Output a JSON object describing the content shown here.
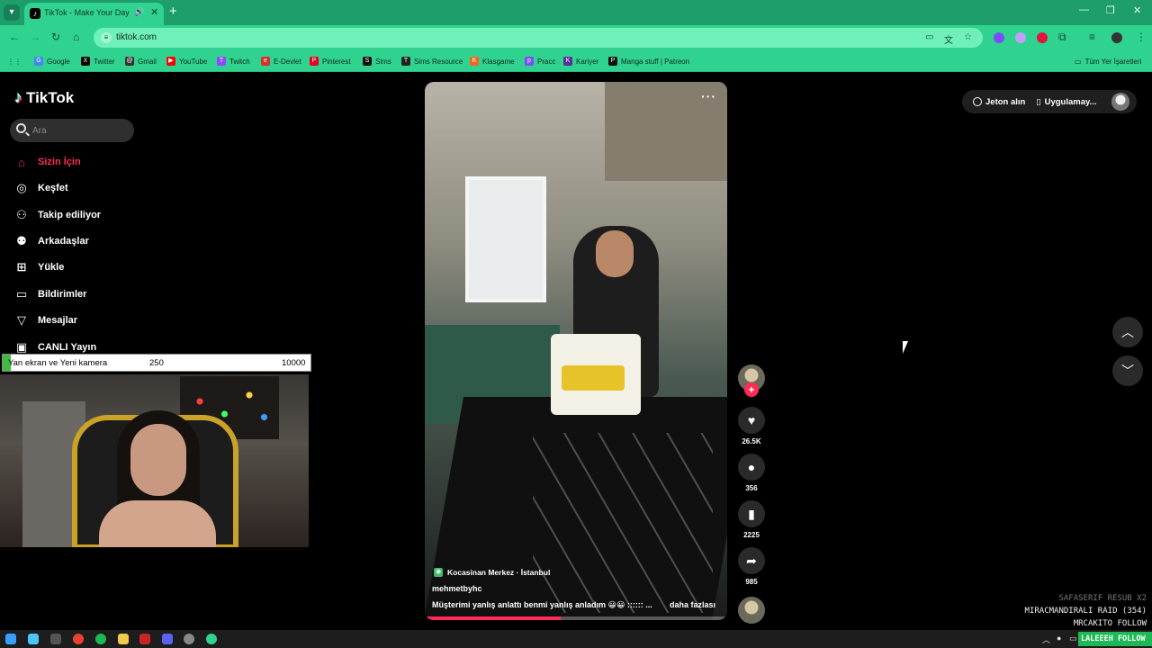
{
  "browser": {
    "tab": {
      "title": "TikTok - Make Your Day",
      "favicon": "tiktok-icon"
    },
    "url": "tiktok.com",
    "bookmarks": [
      {
        "label": "Google",
        "color": "#4285f4",
        "glyph": "G"
      },
      {
        "label": "Twitter",
        "color": "#000000",
        "glyph": "X"
      },
      {
        "label": "Gmail",
        "color": "#333333",
        "glyph": "@"
      },
      {
        "label": "YouTube",
        "color": "#ff0000",
        "glyph": "▶"
      },
      {
        "label": "Twitch",
        "color": "#9146ff",
        "glyph": "T"
      },
      {
        "label": "E-Devlet",
        "color": "#d9302b",
        "glyph": "e"
      },
      {
        "label": "Pinterest",
        "color": "#e60023",
        "glyph": "P"
      },
      {
        "label": "Sims",
        "color": "#111111",
        "glyph": "S"
      },
      {
        "label": "Sims Resource",
        "color": "#222222",
        "glyph": "T"
      },
      {
        "label": "Klasgame",
        "color": "#f26522",
        "glyph": "K"
      },
      {
        "label": "Pracc",
        "color": "#7c4dff",
        "glyph": "p"
      },
      {
        "label": "Kariyer",
        "color": "#5a2ca0",
        "glyph": "K"
      },
      {
        "label": "Manga stuff | Patreon",
        "color": "#111111",
        "glyph": "P"
      }
    ],
    "all_bookmarks": "Tüm Yer İşaretleri"
  },
  "sidebar": {
    "logo": "TikTok",
    "search_placeholder": "Ara",
    "items": [
      {
        "label": "Sizin İçin",
        "icon": "home-icon",
        "glyph": "⌂",
        "active": true
      },
      {
        "label": "Keşfet",
        "icon": "compass-icon",
        "glyph": "◎"
      },
      {
        "label": "Takip ediliyor",
        "icon": "following-icon",
        "glyph": "⚇"
      },
      {
        "label": "Arkadaşlar",
        "icon": "friends-icon",
        "glyph": "⚉"
      },
      {
        "label": "Yükle",
        "icon": "upload-icon",
        "glyph": "⊞"
      },
      {
        "label": "Bildirimler",
        "icon": "notifications-icon",
        "glyph": "▭"
      },
      {
        "label": "Mesajlar",
        "icon": "messages-icon",
        "glyph": "▽"
      },
      {
        "label": "CANLI Yayın",
        "icon": "live-icon",
        "glyph": "▣"
      }
    ]
  },
  "overlay": {
    "label": "Yan ekran ve Yeni kamera",
    "current": "250",
    "goal": "10000",
    "progress": 0.025
  },
  "video": {
    "location": "Kocasinan Merkez · İstanbul",
    "username": "mehmetbyhc",
    "caption": "Müşterimi yanlış anlattı benmi yanlış anladım 😀😀 :::::: ...",
    "more_label": "daha fazlası",
    "progress": 0.45
  },
  "actions": {
    "likes": "26.5K",
    "comments": "356",
    "saves": "2225",
    "shares": "985"
  },
  "header_actions": {
    "coins": "Jeton alın",
    "app": "Uygulamay..."
  },
  "chat": {
    "lines": [
      {
        "text": "SAFASERIF RESUB X2",
        "faded": true
      },
      {
        "text": "MIRACMANDIRALI RAID (354)",
        "faded": false
      },
      {
        "text": "MRCAKITO FOLLOW",
        "faded": false
      }
    ],
    "banner": "LALEEEH FOLLOW"
  }
}
